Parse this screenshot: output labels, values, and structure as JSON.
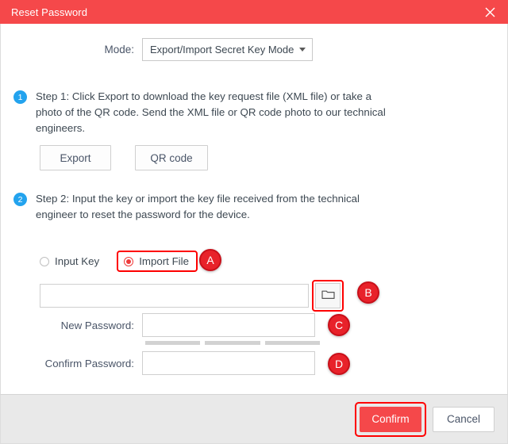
{
  "window": {
    "title": "Reset Password",
    "close_icon": "close-icon"
  },
  "mode": {
    "label": "Mode:",
    "selected_option": "Export/Import Secret Key Mode",
    "caret_icon": "chevron-down-icon"
  },
  "steps": [
    {
      "number": "1",
      "text": "Step 1: Click Export to download the key request file (XML file) or take a photo of the QR code. Send the XML file or QR code photo to our technical engineers."
    },
    {
      "number": "2",
      "text": "Step 2: Input the key or import the key file received from the technical engineer to reset the password for the device."
    }
  ],
  "actions": {
    "export_label": "Export",
    "qr_label": "QR code"
  },
  "key_source": {
    "input_key_label": "Input Key",
    "import_file_label": "Import File",
    "selected": "Import File",
    "folder_icon": "folder-icon",
    "file_path_value": ""
  },
  "password": {
    "new_label": "New Password:",
    "new_value": "",
    "confirm_label": "Confirm Password:",
    "confirm_value": "",
    "strength_segments": [
      "",
      "",
      ""
    ]
  },
  "annotations": [
    {
      "id": "A",
      "label": "A"
    },
    {
      "id": "B",
      "label": "B"
    },
    {
      "id": "C",
      "label": "C"
    },
    {
      "id": "D",
      "label": "D"
    }
  ],
  "footer": {
    "confirm_label": "Confirm",
    "cancel_label": "Cancel"
  },
  "colors": {
    "titlebar": "#f5484a",
    "step_badge": "#23a3ee",
    "highlight": "#fe0000",
    "annotation": "#e8222a",
    "confirm": "#f5484a"
  }
}
